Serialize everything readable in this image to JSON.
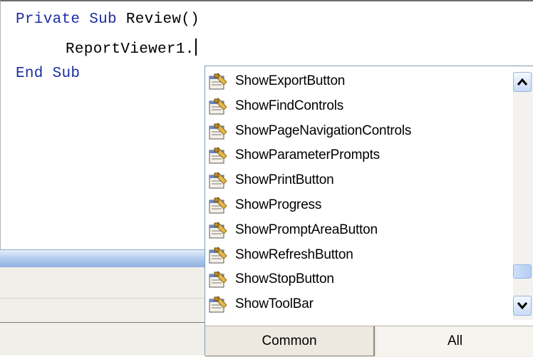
{
  "code": {
    "line1": {
      "keyword1": "Private",
      "keyword2": "Sub",
      "name": "Review()"
    },
    "line2": {
      "text": "ReportViewer1."
    },
    "line3": {
      "keyword1": "End",
      "keyword2": "Sub"
    }
  },
  "completion": {
    "items": [
      {
        "label": "ShowExportButton",
        "icon": "property-icon"
      },
      {
        "label": "ShowFindControls",
        "icon": "property-icon"
      },
      {
        "label": "ShowPageNavigationControls",
        "icon": "property-icon"
      },
      {
        "label": "ShowParameterPrompts",
        "icon": "property-icon"
      },
      {
        "label": "ShowPrintButton",
        "icon": "property-icon"
      },
      {
        "label": "ShowProgress",
        "icon": "property-icon"
      },
      {
        "label": "ShowPromptAreaButton",
        "icon": "property-icon"
      },
      {
        "label": "ShowRefreshButton",
        "icon": "property-icon"
      },
      {
        "label": "ShowStopButton",
        "icon": "property-icon"
      },
      {
        "label": "ShowToolBar",
        "icon": "property-icon"
      }
    ],
    "tabs": {
      "common": "Common",
      "all": "All"
    }
  },
  "colors": {
    "keyword": "#1b2ea0",
    "scrollbar_accent": "#c9dbf7",
    "pane_strip": "#b6cdee"
  }
}
